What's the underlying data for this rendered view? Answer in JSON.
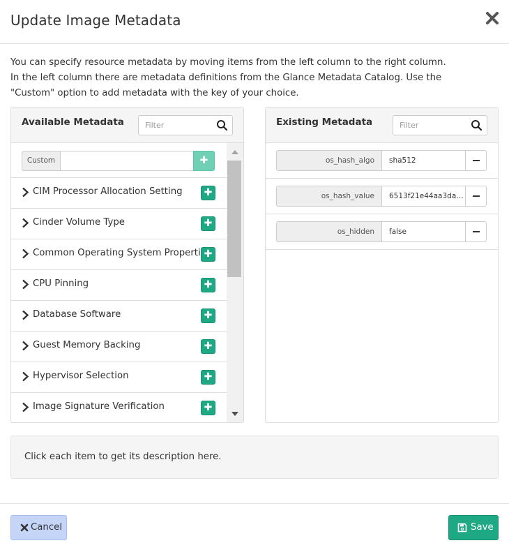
{
  "dialog": {
    "title": "Update Image Metadata",
    "intro": "You can specify resource metadata by moving items from the left column to the right column. In the left column there are metadata definitions from the Glance Metadata Catalog. Use the \"Custom\" option to add metadata with the key of your choice."
  },
  "available": {
    "title": "Available Metadata",
    "filter_placeholder": "Filter",
    "custom_label": "Custom",
    "custom_value": "",
    "items": [
      {
        "label": "CIM Processor Allocation Setting"
      },
      {
        "label": "Cinder Volume Type"
      },
      {
        "label": "Common Operating System Properties"
      },
      {
        "label": "CPU Pinning"
      },
      {
        "label": "Database Software"
      },
      {
        "label": "Guest Memory Backing"
      },
      {
        "label": "Hypervisor Selection"
      },
      {
        "label": "Image Signature Verification"
      }
    ]
  },
  "existing": {
    "title": "Existing Metadata",
    "filter_placeholder": "Filter",
    "rows": [
      {
        "key": "os_hash_algo",
        "value": "sha512"
      },
      {
        "key": "os_hash_value",
        "value": "6513f21e44aa3da349..."
      },
      {
        "key": "os_hidden",
        "value": "false"
      }
    ]
  },
  "description": {
    "text": "Click each item to get its description here."
  },
  "footer": {
    "cancel_label": "Cancel",
    "save_label": "Save"
  },
  "colors": {
    "accent_green": "#1fa884",
    "accent_green_light": "#6fd0b5",
    "cancel_blue": "#c5d5f8",
    "panel_header": "#f5f5f5"
  },
  "icons": {
    "close": "close-icon",
    "search": "search-icon",
    "chevron": "chevron-right-icon",
    "plus": "plus-icon",
    "minus": "minus-icon",
    "cancel": "x-icon",
    "save": "floppy-disk-icon"
  }
}
